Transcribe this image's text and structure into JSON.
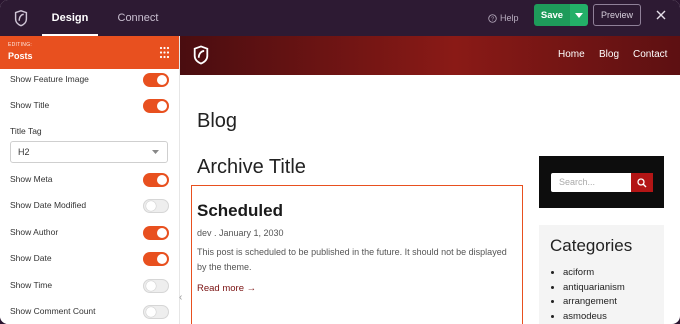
{
  "topbar": {
    "tabs": [
      {
        "label": "Design"
      },
      {
        "label": "Connect"
      }
    ],
    "help_label": "Help",
    "save_label": "Save",
    "preview_label": "Preview"
  },
  "sidebar": {
    "editing_label": "EDITING:",
    "section_title": "Posts",
    "settings": [
      {
        "label": "Show Feature Image",
        "on": true
      },
      {
        "label": "Show Title",
        "on": true
      },
      {
        "label": "Show Meta",
        "on": true
      },
      {
        "label": "Show Date Modified",
        "on": false
      },
      {
        "label": "Show Author",
        "on": true
      },
      {
        "label": "Show Date",
        "on": true
      },
      {
        "label": "Show Time",
        "on": false
      },
      {
        "label": "Show Comment Count",
        "on": false
      }
    ],
    "title_tag_label": "Title Tag",
    "title_tag_value": "H2"
  },
  "preview": {
    "nav": [
      "Home",
      "Blog",
      "Contact"
    ],
    "page_title": "Blog",
    "archive_title": "Archive Title",
    "post": {
      "title": "Scheduled",
      "meta": "dev . January 1, 2030",
      "excerpt": "This post is scheduled to be published in the future. It should not be displayed by the theme.",
      "read_more": "Read more →"
    },
    "search_placeholder": "Search...",
    "categories_title": "Categories",
    "categories": [
      "aciform",
      "antiquarianism",
      "arrangement",
      "asmodeus"
    ]
  },
  "colors": {
    "accent": "#e8501f",
    "save_green": "#1e9b5a",
    "topbar": "#2d1a33",
    "hero_red": "#8a1a16"
  }
}
